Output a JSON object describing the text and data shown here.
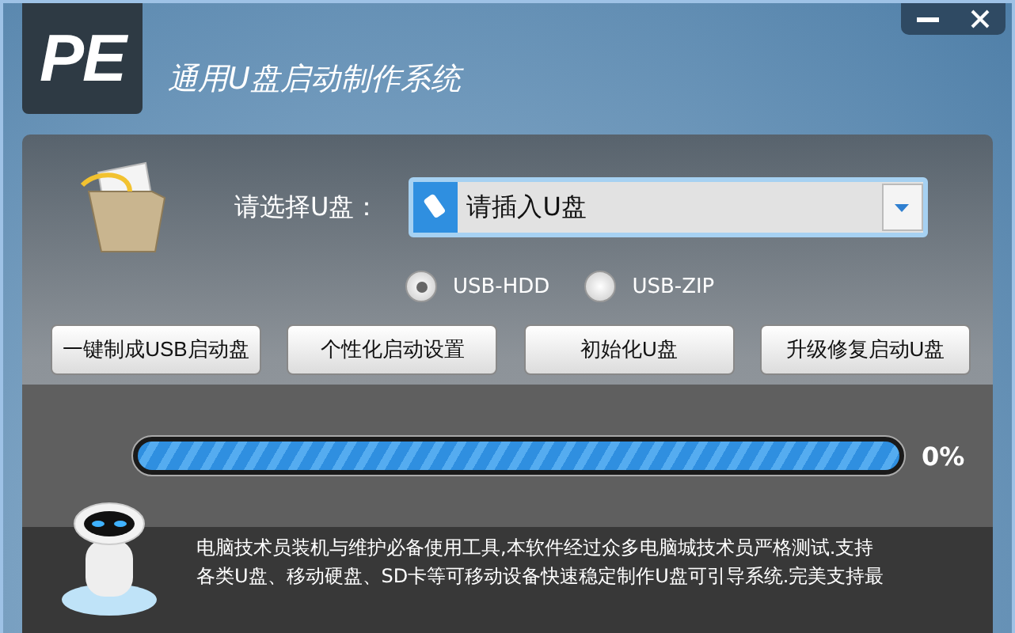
{
  "window": {
    "logo": "PE",
    "title": "通用U盘启动制作系统"
  },
  "drive_select": {
    "label": "请选择U盘：",
    "value": "请插入U盘"
  },
  "modes": [
    {
      "label": "USB-HDD",
      "selected": true
    },
    {
      "label": "USB-ZIP",
      "selected": false
    }
  ],
  "buttons": [
    "一键制成USB启动盘",
    "个性化启动设置",
    "初始化U盘",
    "升级修复启动U盘"
  ],
  "progress": {
    "level": 0,
    "reading": "0%"
  },
  "description": [
    "电脑技术员装机与维护必备使用工具,本软件经过众多电脑城技术员严格测试.支持",
    "各类U盘、移动硬盘、SD卡等可移动设备快速稳定制作U盘可引导系统.完美支持最"
  ]
}
